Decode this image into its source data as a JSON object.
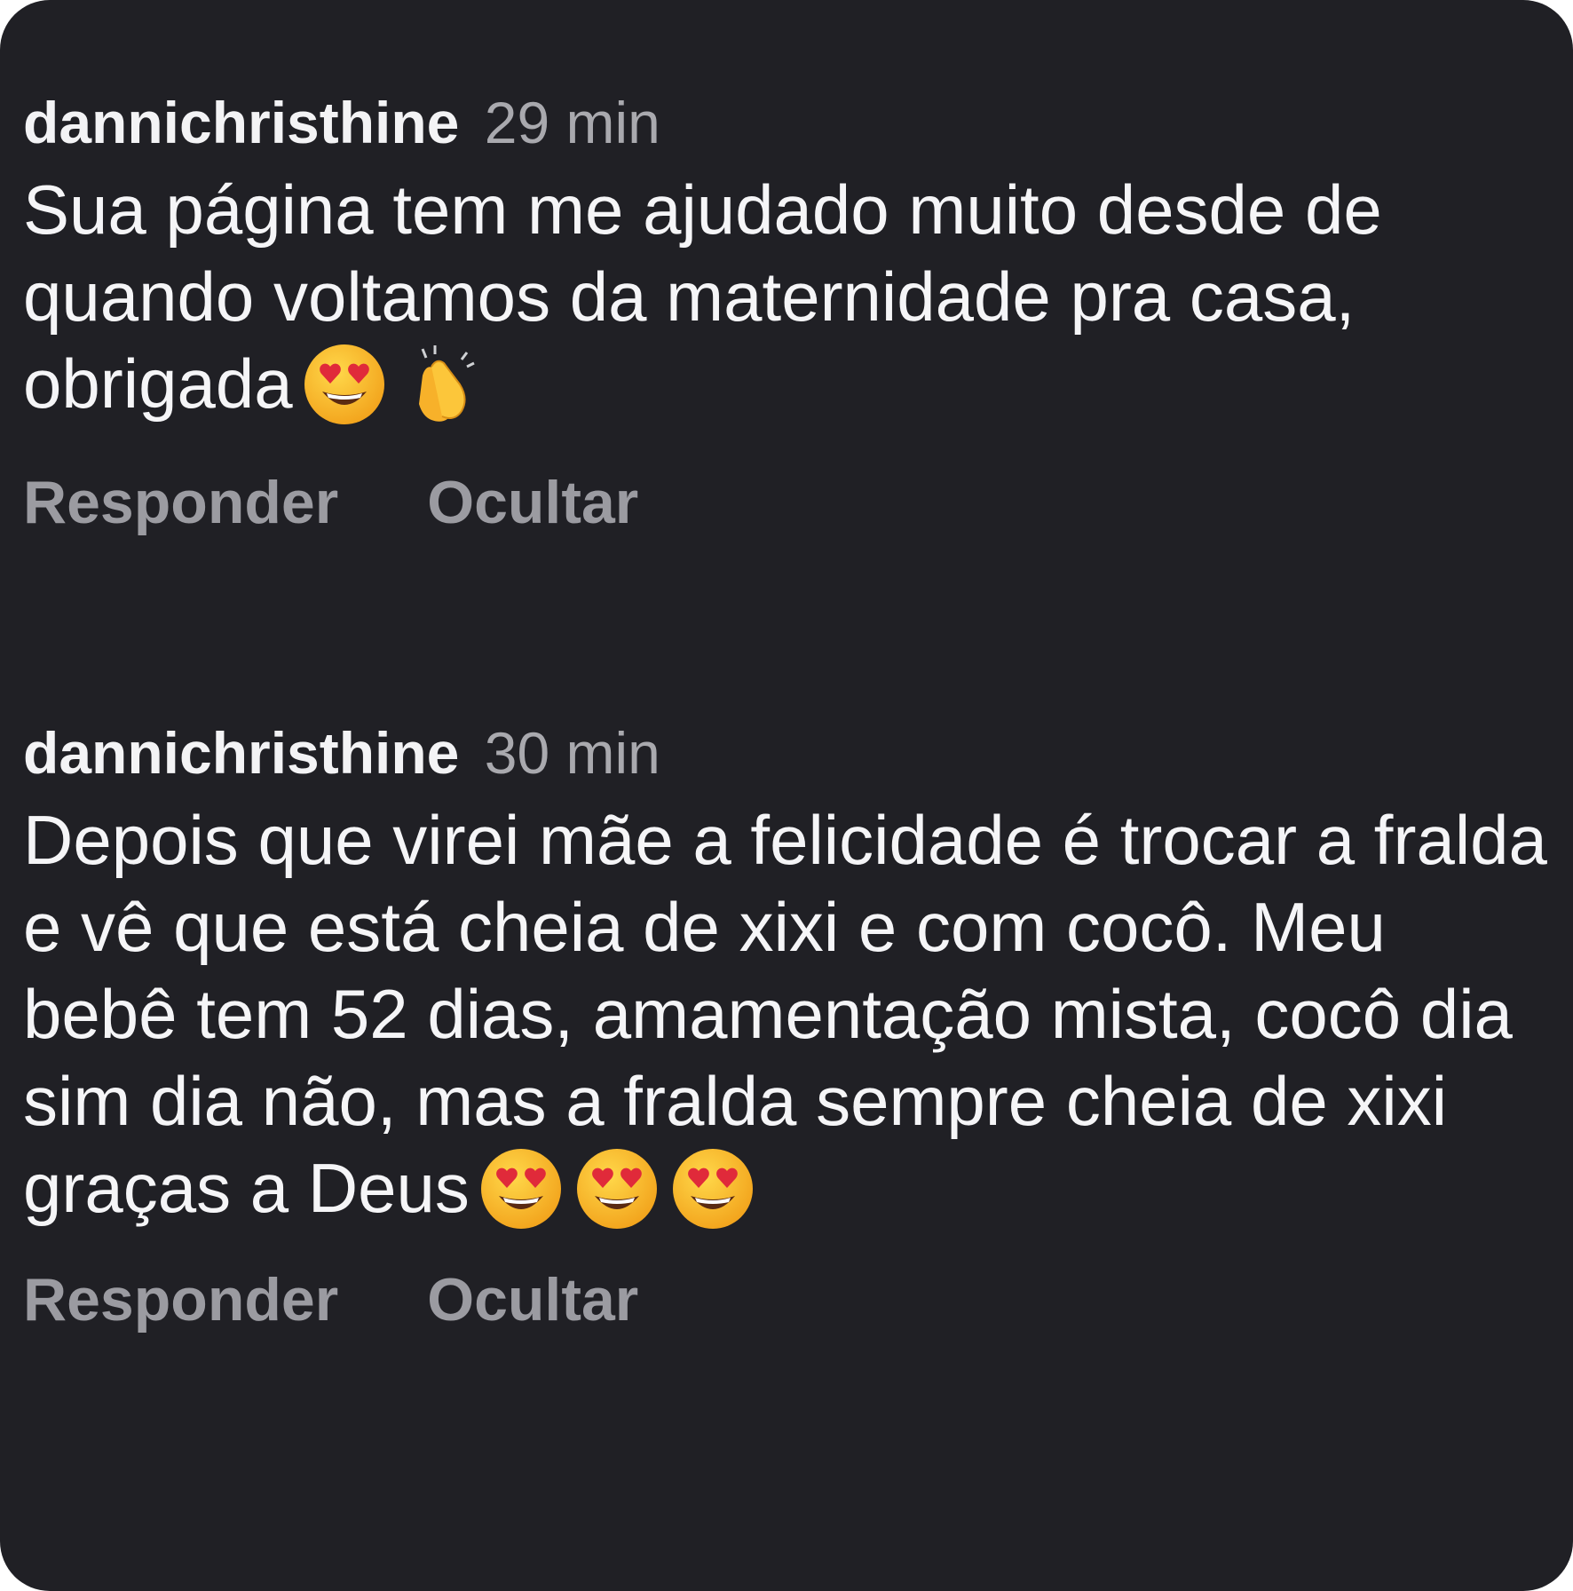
{
  "comments": [
    {
      "username": "dannichristhine",
      "time": "29 min",
      "text": "Sua página tem me ajudado muito desde de quando voltamos da maternidade pra casa, obrigada",
      "emojis": [
        "heart-eyes",
        "clapping-hands"
      ],
      "reply_label": "Responder",
      "hide_label": "Ocultar"
    },
    {
      "username": "dannichristhine",
      "time": "30 min",
      "text": "Depois que virei mãe a felicidade é trocar a fralda e vê que está cheia de xixi e com cocô. Meu bebê tem 52 dias, amamentação mista, cocô dia sim dia não, mas a fralda sempre cheia de xixi graças a Deus",
      "emojis": [
        "heart-eyes",
        "heart-eyes",
        "heart-eyes"
      ],
      "reply_label": "Responder",
      "hide_label": "Ocultar"
    }
  ],
  "colors": {
    "background": "#202025",
    "text": "#f5f5f7",
    "muted": "#9b9ba1"
  }
}
